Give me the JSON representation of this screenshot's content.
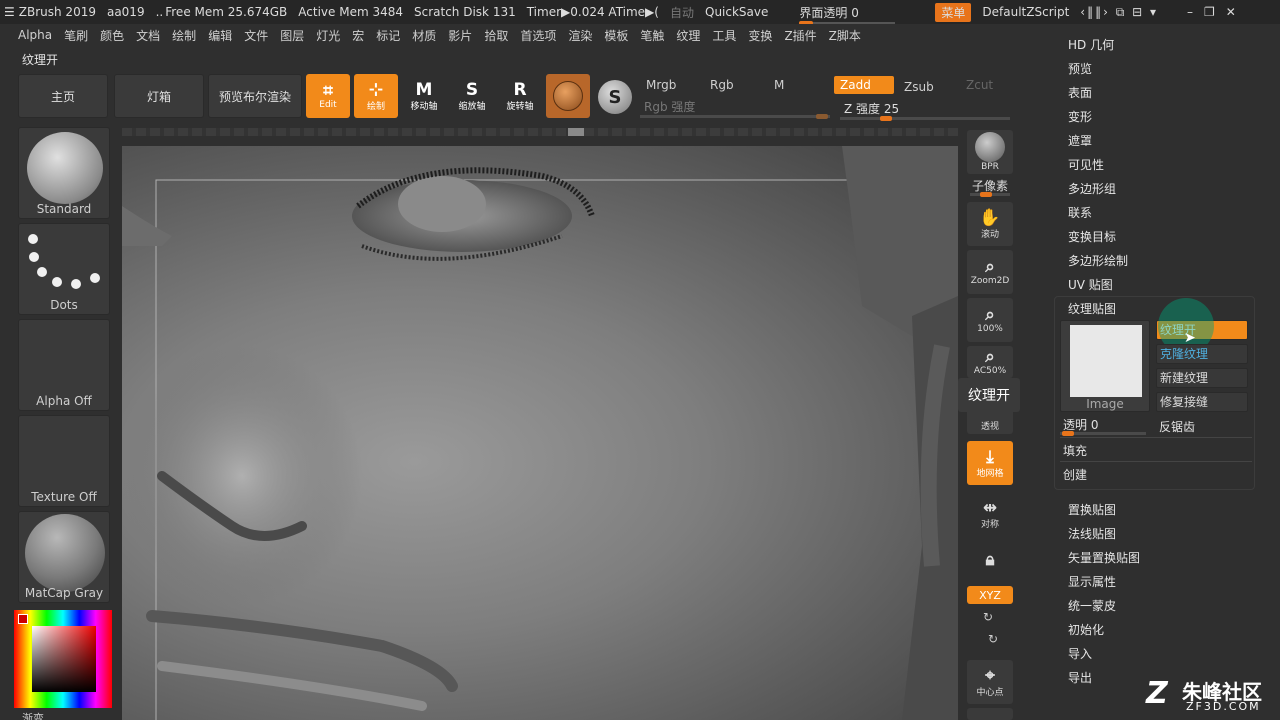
{
  "titlebar": {
    "app": "ZBrush 2019",
    "project": "aa019",
    "dots": "..",
    "free_mem": "Free Mem 25.674GB",
    "active_mem": "Active Mem 3484",
    "scratch": "Scratch Disk 131",
    "timer": "Timer▶0.024 ATime▶(",
    "auto": "自动",
    "quicksave": "QuickSave",
    "ui_transparency": "界面透明 0",
    "menu_btn": "菜单",
    "script": "DefaultZScript"
  },
  "menubar": [
    "Alpha",
    "笔刷",
    "颜色",
    "文档",
    "绘制",
    "编辑",
    "文件",
    "图层",
    "灯光",
    "宏",
    "标记",
    "材质",
    "影片",
    "拾取",
    "首选项",
    "渲染",
    "模板",
    "笔触",
    "纹理",
    "工具",
    "变换",
    "Z插件",
    "Z脚本"
  ],
  "palette_title": "纹理开",
  "shelf": {
    "home": "主页",
    "lightbox": "灯箱",
    "bpr": "预览布尔渲染",
    "edit": "Edit",
    "draw": "绘制",
    "move": "移动轴",
    "scale": "缩放轴",
    "rotate": "旋转轴",
    "mrgb": "Mrgb",
    "rgb": "Rgb",
    "m": "M",
    "zadd": "Zadd",
    "zsub": "Zsub",
    "zcut": "Zcut",
    "rgb_intensity": "Rgb 强度",
    "z_intensity": "Z 强度 25",
    "z_intensity_value": 25
  },
  "left": {
    "brush": "Standard",
    "stroke": "Dots",
    "alpha": "Alpha Off",
    "texture": "Texture Off",
    "material": "MatCap Gray",
    "gradient": "渐变"
  },
  "right": {
    "bpr": "BPR",
    "subpixel": "子像素",
    "scroll": "滚动",
    "zoom2d": "Zoom2D",
    "pct100": "100%",
    "ac50": "AC50%",
    "persp": "透视",
    "floor": "地网格",
    "frame": "对称",
    "xyz": "XYZ",
    "center": "中心点",
    "tooltip": "纹理开"
  },
  "menu": {
    "items_top": [
      "HD 几何",
      "预览",
      "表面",
      "变形",
      "遮罩",
      "可见性",
      "多边形组",
      "联系",
      "变换目标",
      "多边形绘制",
      "UV 贴图"
    ],
    "texture_map": "纹理贴图",
    "image_label": "Image",
    "btn_texture_on": "纹理开",
    "btn_clone": "克隆纹理",
    "btn_new": "新建纹理",
    "btn_fix": "修复接缝",
    "opacity": "透明 0",
    "antialias": "反锯齿",
    "fill": "填充",
    "create": "创建",
    "items_bottom": [
      "置换贴图",
      "法线贴图",
      "矢量置换贴图",
      "显示属性",
      "统一蒙皮",
      "初始化",
      "导入",
      "导出"
    ]
  },
  "watermark": {
    "name": "朱峰社区",
    "url": "ZF3D.COM"
  },
  "colors": {
    "accent": "#f28a1a",
    "panel": "#2f2f2f",
    "button": "#3a3a3a"
  }
}
